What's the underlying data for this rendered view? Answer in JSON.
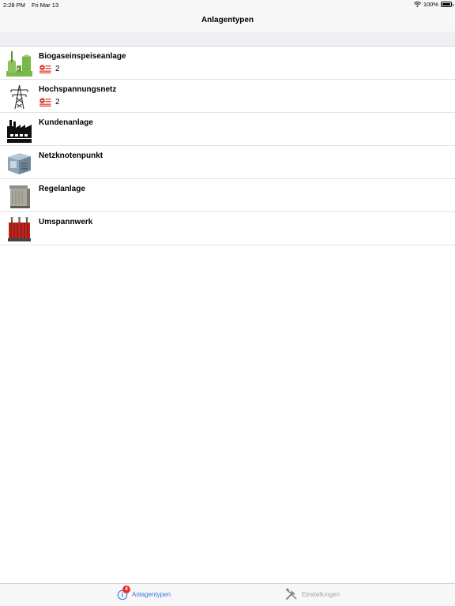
{
  "status_bar": {
    "time": "2:28 PM",
    "date": "Fri Mar 13",
    "battery": "100%"
  },
  "nav": {
    "title": "Anlagentypen"
  },
  "list": [
    {
      "title": "Biogaseinspeiseanlage",
      "icon": "biogas-plant-icon",
      "count": "2"
    },
    {
      "title": "Hochspannungsnetz",
      "icon": "power-pylon-icon",
      "count": "2"
    },
    {
      "title": "Kundenanlage",
      "icon": "factory-icon"
    },
    {
      "title": "Netzknotenpunkt",
      "icon": "grid-node-icon"
    },
    {
      "title": "Regelanlage",
      "icon": "control-station-icon"
    },
    {
      "title": "Umspannwerk",
      "icon": "substation-icon"
    }
  ],
  "tabs": {
    "anlagentypen": {
      "label": "Anlagentypen",
      "badge": "4",
      "icon": "info-icon",
      "color": "#2f7ad8"
    },
    "einstellungen": {
      "label": "Einstellungen",
      "icon": "tools-icon",
      "color": "#a3a3a3"
    }
  },
  "colors": {
    "accent": "#2f7ad8",
    "badge": "#e8322e",
    "bar_bg": "#f7f7f7"
  }
}
